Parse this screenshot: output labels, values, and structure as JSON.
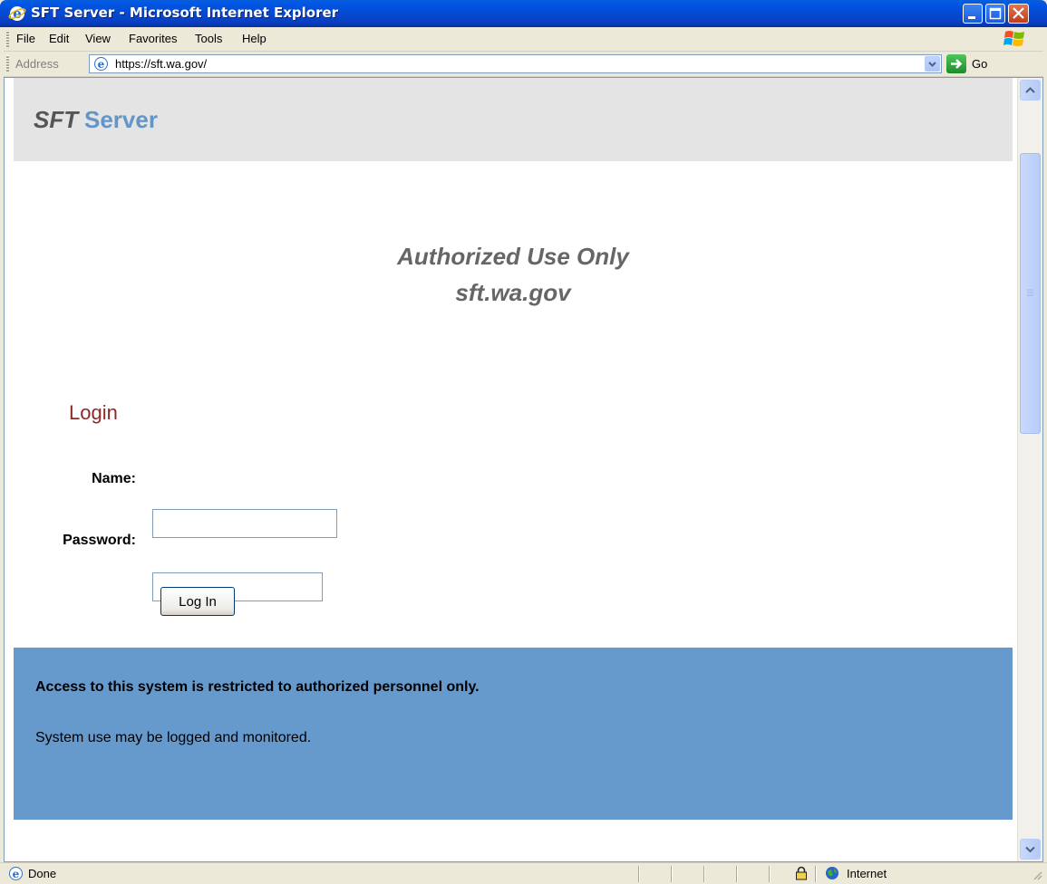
{
  "window": {
    "title": "SFT Server - Microsoft Internet Explorer"
  },
  "menu": {
    "items": [
      "File",
      "Edit",
      "View",
      "Favorites",
      "Tools",
      "Help"
    ]
  },
  "address": {
    "label": "Address",
    "url": "https://sft.wa.gov/",
    "go_label": "Go"
  },
  "page": {
    "brand_sft": "SFT",
    "brand_server": "Server",
    "auth_line1": "Authorized Use Only",
    "auth_line2": "sft.wa.gov",
    "login_heading": "Login",
    "name_label": "Name:",
    "password_label": "Password:",
    "name_value": "",
    "password_value": "",
    "login_button": "Log In",
    "notice_strong": "Access to this system is restricted to authorized personnel only.",
    "notice_text": "System use may be logged and monitored.",
    "colors": {
      "header_bg": "#e4e4e4",
      "brand_accent": "#6395c6",
      "login_heading": "#8b2a2a",
      "footer_bg": "#6699cc"
    }
  },
  "status": {
    "text": "Done",
    "zone": "Internet"
  }
}
